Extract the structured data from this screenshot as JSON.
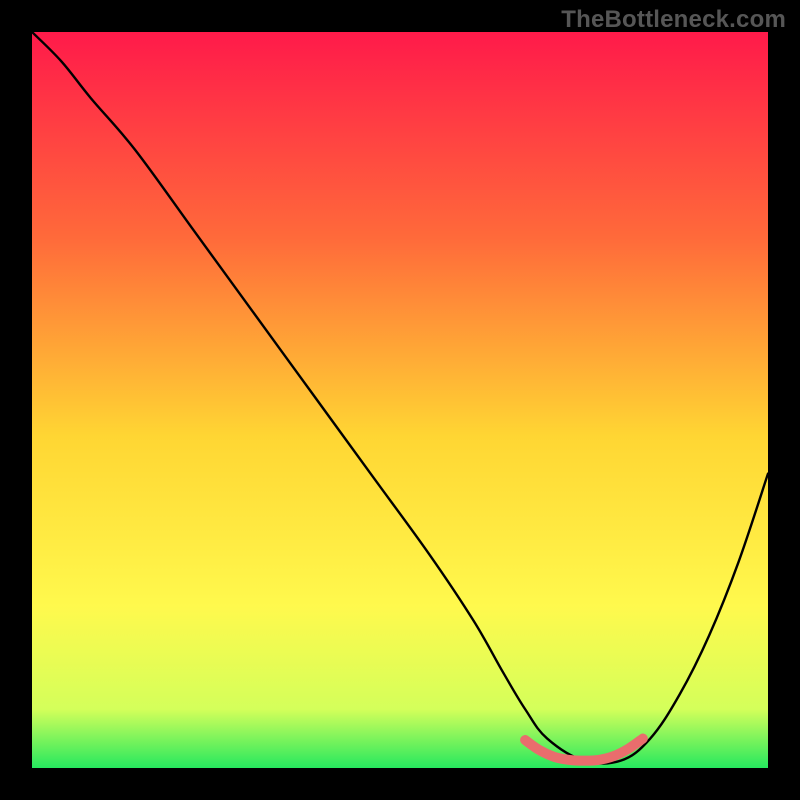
{
  "watermark": "TheBottleneck.com",
  "chart_data": {
    "type": "line",
    "title": "",
    "xlabel": "",
    "ylabel": "",
    "xlim": [
      0,
      100
    ],
    "ylim": [
      0,
      100
    ],
    "grid": false,
    "background_gradient": {
      "stops": [
        {
          "offset": 0,
          "color": "#ff1a4a"
        },
        {
          "offset": 28,
          "color": "#ff6a3a"
        },
        {
          "offset": 55,
          "color": "#ffd633"
        },
        {
          "offset": 78,
          "color": "#fff94d"
        },
        {
          "offset": 92,
          "color": "#d4ff5a"
        },
        {
          "offset": 100,
          "color": "#26e85e"
        }
      ]
    },
    "series": [
      {
        "name": "curve",
        "color": "#000000",
        "x": [
          0,
          4,
          8,
          14,
          22,
          30,
          38,
          46,
          54,
          60,
          64,
          67,
          70,
          75,
          80,
          84,
          88,
          92,
          96,
          100
        ],
        "y": [
          100,
          96,
          91,
          84,
          73,
          62,
          51,
          40,
          29,
          20,
          13,
          8,
          4,
          1,
          1,
          4,
          10,
          18,
          28,
          40
        ]
      },
      {
        "name": "optimal-region",
        "color": "#e96d6d",
        "x": [
          67,
          69,
          71,
          73,
          75,
          77,
          79,
          81,
          83
        ],
        "y": [
          3.8,
          2.4,
          1.5,
          1.1,
          1.0,
          1.1,
          1.6,
          2.6,
          4.0
        ]
      }
    ]
  }
}
